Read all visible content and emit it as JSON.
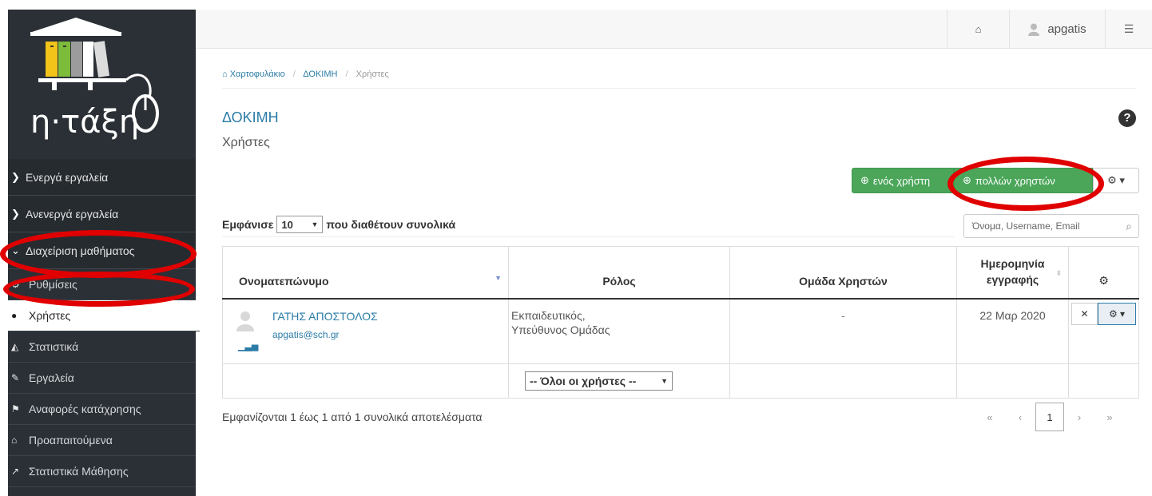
{
  "app": {
    "logo_text": "η·τάξη"
  },
  "sidebar": {
    "groups": [
      {
        "label": "Ενεργά εργαλεία",
        "icon": "chevron-right-icon"
      },
      {
        "label": "Ανενεργά εργαλεία",
        "icon": "chevron-right-icon"
      },
      {
        "label": "Διαχείριση μαθήματος",
        "icon": "chevron-down-icon"
      }
    ],
    "items": [
      {
        "label": "Ρυθμίσεις",
        "icon": "cogs-icon"
      },
      {
        "label": "Χρήστες",
        "icon": "user-icon"
      },
      {
        "label": "Στατιστικά",
        "icon": "area-chart-icon"
      },
      {
        "label": "Εργαλεία",
        "icon": "wrench-icon"
      },
      {
        "label": "Αναφορές κατάχρησης",
        "icon": "flag-icon"
      },
      {
        "label": "Προαπαιτούμενα",
        "icon": "university-icon"
      },
      {
        "label": "Στατιστικά Μάθησης",
        "icon": "line-chart-icon"
      }
    ]
  },
  "topbar": {
    "username": "apgatis"
  },
  "breadcrumb": {
    "home": "Χαρτοφυλάκιο",
    "course": "ΔΟΚΙΜΗ",
    "current": "Χρήστες"
  },
  "page": {
    "title": "ΔΟΚΙΜΗ",
    "subtitle": "Χρήστες",
    "help_symbol": "?"
  },
  "actions": {
    "add_one": "ενός χρήστη",
    "add_many": "πολλών χρηστών"
  },
  "table_controls": {
    "show_label": "Εμφάνισε",
    "page_size": "10",
    "show_suffix": "που διαθέτουν συνολικά",
    "search_placeholder": "Όνομα, Username, Email"
  },
  "table": {
    "columns": [
      "Ονοματεπώνυμο",
      "Ρόλος",
      "Ομάδα Χρηστών",
      "Ημερομηνία εγγραφής"
    ],
    "rows": [
      {
        "name": "ΓΑΤΗΣ ΑΠΟΣΤΟΛΟΣ",
        "email": "apgatis@sch.gr",
        "role_line1": "Εκπαιδευτικός,",
        "role_line2": "Υπεύθυνος Ομάδας",
        "group": "-",
        "date": "22 Μαρ 2020"
      }
    ],
    "filter_value": "-- Όλοι οι χρήστες --"
  },
  "footer": {
    "results_info": "Εμφανίζονται 1 έως 1 από 1 συνολικά αποτελέσματα",
    "pager": [
      "«",
      "‹",
      "1",
      "›",
      "»"
    ]
  },
  "highlight_color": "#e00000"
}
